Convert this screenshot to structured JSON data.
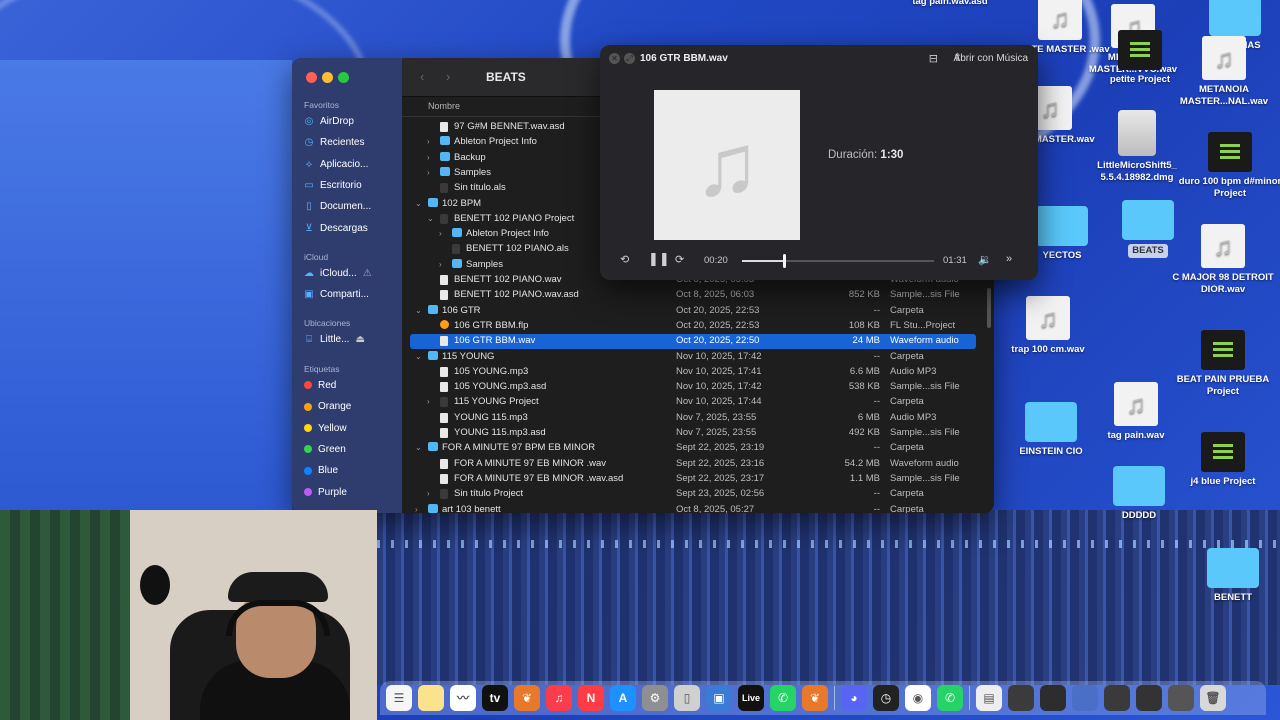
{
  "desktop": {
    "icons": [
      {
        "label": "tag pain.wav.asd"
      },
      {
        "label": "PETITE MASTER .wav"
      },
      {
        "label": "METENOIA MASTER...VVC.wav"
      },
      {
        "label": "LIBRERIAS"
      },
      {
        "label": "petite Project"
      },
      {
        "label": "METANOIA MASTER...NAL.wav"
      },
      {
        "label": "BLUE MASTER.wav"
      },
      {
        "label": "LittleMicroShift5_ 5.5.4.18982.dmg"
      },
      {
        "label": "duro 100 bpm d#minor Project"
      },
      {
        "label": "YECTOS"
      },
      {
        "label": "BEATS"
      },
      {
        "label": "C MAJOR 98 DETROIT DIOR.wav"
      },
      {
        "label": "trap 100 cm.wav"
      },
      {
        "label": "BEAT PAIN PRUEBA Project"
      },
      {
        "label": "tag pain.wav"
      },
      {
        "label": "EINSTEIN CIO"
      },
      {
        "label": "j4 blue Project"
      },
      {
        "label": "DDDDD"
      },
      {
        "label": "BENETT"
      }
    ]
  },
  "finder": {
    "title": "BEATS",
    "sidebar": {
      "favorites_header": "Favoritos",
      "favorites": [
        {
          "label": "AirDrop",
          "icon": "airdrop-icon"
        },
        {
          "label": "Recientes",
          "icon": "clock-icon"
        },
        {
          "label": "Aplicacio...",
          "icon": "applications-icon"
        },
        {
          "label": "Escritorio",
          "icon": "desktop-icon"
        },
        {
          "label": "Documen...",
          "icon": "document-icon"
        },
        {
          "label": "Descargas",
          "icon": "download-icon"
        }
      ],
      "icloud_header": "iCloud",
      "icloud": [
        {
          "label": "iCloud...",
          "icon": "cloud-icon"
        },
        {
          "label": "Comparti...",
          "icon": "shared-folder-icon"
        }
      ],
      "locations_header": "Ubicaciones",
      "locations": [
        {
          "label": "Little...",
          "icon": "disk-icon"
        }
      ],
      "tags_header": "Etiquetas",
      "tags": [
        {
          "label": "Red",
          "color": "#ff453a"
        },
        {
          "label": "Orange",
          "color": "#ff9f0a"
        },
        {
          "label": "Yellow",
          "color": "#ffd60a"
        },
        {
          "label": "Green",
          "color": "#32d74b"
        },
        {
          "label": "Blue",
          "color": "#0a84ff"
        },
        {
          "label": "Purple",
          "color": "#bf5af2"
        }
      ]
    },
    "columns": {
      "name": "Nombre"
    },
    "rows": [
      {
        "name": "97 G#M BENNET.wav.asd",
        "date": "",
        "size": "",
        "kind": "",
        "type": "file",
        "indent": 1,
        "chev": ""
      },
      {
        "name": "Ableton Project Info",
        "date": "",
        "size": "",
        "kind": "",
        "type": "folder",
        "indent": 1,
        "chev": "›"
      },
      {
        "name": "Backup",
        "date": "",
        "size": "",
        "kind": "",
        "type": "folder",
        "indent": 1,
        "chev": "›"
      },
      {
        "name": "Samples",
        "date": "",
        "size": "",
        "kind": "",
        "type": "folder",
        "indent": 1,
        "chev": "›"
      },
      {
        "name": "Sin título.als",
        "date": "",
        "size": "",
        "kind": "",
        "type": "proj",
        "indent": 1,
        "chev": ""
      },
      {
        "name": "102 BPM",
        "date": "",
        "size": "",
        "kind": "",
        "type": "folder",
        "indent": 0,
        "chev": "⌄"
      },
      {
        "name": "BENETT 102 PIANO Project",
        "date": "",
        "size": "",
        "kind": "",
        "type": "proj",
        "indent": 1,
        "chev": "⌄"
      },
      {
        "name": "Ableton Project Info",
        "date": "",
        "size": "",
        "kind": "",
        "type": "folder",
        "indent": 2,
        "chev": "›"
      },
      {
        "name": "BENETT 102 PIANO.als",
        "date": "",
        "size": "",
        "kind": "",
        "type": "proj",
        "indent": 2,
        "chev": ""
      },
      {
        "name": "Samples",
        "date": "",
        "size": "",
        "kind": "",
        "type": "folder",
        "indent": 2,
        "chev": "›"
      },
      {
        "name": "BENETT 102 PIANO.wav",
        "date": "Oct 8, 2025, 05:03",
        "size": "",
        "kind": "Waveform audio",
        "type": "file",
        "indent": 1,
        "chev": ""
      },
      {
        "name": "BENETT 102 PIANO.wav.asd",
        "date": "Oct 8, 2025, 06:03",
        "size": "852 KB",
        "kind": "Sample...sis File",
        "type": "file",
        "indent": 1,
        "chev": ""
      },
      {
        "name": "106 GTR",
        "date": "Oct 20, 2025, 22:53",
        "size": "--",
        "kind": "Carpeta",
        "type": "folder",
        "indent": 0,
        "chev": "⌄"
      },
      {
        "name": "106 GTR BBM.flp",
        "date": "Oct 20, 2025, 22:53",
        "size": "108 KB",
        "kind": "FL Stu...Project",
        "type": "flp",
        "indent": 1,
        "chev": ""
      },
      {
        "name": "106 GTR BBM.wav",
        "date": "Oct 20, 2025, 22:50",
        "size": "24 MB",
        "kind": "Waveform audio",
        "type": "file",
        "indent": 1,
        "chev": "",
        "selected": true
      },
      {
        "name": "115 YOUNG",
        "date": "Nov 10, 2025, 17:42",
        "size": "--",
        "kind": "Carpeta",
        "type": "folder",
        "indent": 0,
        "chev": "⌄"
      },
      {
        "name": "105 YOUNG.mp3",
        "date": "Nov 10, 2025, 17:41",
        "size": "6.6 MB",
        "kind": "Audio MP3",
        "type": "file",
        "indent": 1,
        "chev": ""
      },
      {
        "name": "105 YOUNG.mp3.asd",
        "date": "Nov 10, 2025, 17:42",
        "size": "538 KB",
        "kind": "Sample...sis File",
        "type": "file",
        "indent": 1,
        "chev": ""
      },
      {
        "name": "115 YOUNG  Project",
        "date": "Nov 10, 2025, 17:44",
        "size": "--",
        "kind": "Carpeta",
        "type": "proj",
        "indent": 1,
        "chev": "›"
      },
      {
        "name": "YOUNG 115.mp3",
        "date": "Nov 7, 2025, 23:55",
        "size": "6 MB",
        "kind": "Audio MP3",
        "type": "file",
        "indent": 1,
        "chev": ""
      },
      {
        "name": "YOUNG 115.mp3.asd",
        "date": "Nov 7, 2025, 23:55",
        "size": "492 KB",
        "kind": "Sample...sis File",
        "type": "file",
        "indent": 1,
        "chev": ""
      },
      {
        "name": "FOR A MINUTE 97 BPM EB MINOR",
        "date": "Sept 22, 2025, 23:19",
        "size": "--",
        "kind": "Carpeta",
        "type": "folder",
        "indent": 0,
        "chev": "⌄"
      },
      {
        "name": "FOR A MINUTE 97 EB MINOR .wav",
        "date": "Sept 22, 2025, 23:16",
        "size": "54.2 MB",
        "kind": "Waveform audio",
        "type": "file",
        "indent": 1,
        "chev": ""
      },
      {
        "name": "FOR A MINUTE 97 EB MINOR .wav.asd",
        "date": "Sept 22, 2025, 23:17",
        "size": "1.1 MB",
        "kind": "Sample...sis File",
        "type": "file",
        "indent": 1,
        "chev": ""
      },
      {
        "name": "Sin título Project",
        "date": "Sept 23, 2025, 02:56",
        "size": "--",
        "kind": "Carpeta",
        "type": "proj",
        "indent": 1,
        "chev": "›"
      },
      {
        "name": "art 103 benett",
        "date": "Oct 8, 2025, 05:27",
        "size": "--",
        "kind": "Carpeta",
        "type": "folder",
        "indent": 0,
        "chev": "›"
      }
    ]
  },
  "quicklook": {
    "title": "106 GTR BBM.wav",
    "open_with": "Abrir con Música",
    "duration_label": "Duración:",
    "duration_value": "1:30",
    "elapsed": "00:20",
    "remaining": "01:31",
    "progress": 0.22
  },
  "dock": {
    "apps": [
      {
        "name": "reminders-icon",
        "color": "#f5f5f5",
        "glyph": "☰"
      },
      {
        "name": "notes-icon",
        "color": "#fbe38e",
        "glyph": ""
      },
      {
        "name": "freeform-icon",
        "color": "#ffffff",
        "glyph": "〰"
      },
      {
        "name": "apple-tv-icon",
        "color": "#111111",
        "glyph": "tv"
      },
      {
        "name": "fl-studio-icon",
        "color": "#e8782a",
        "glyph": "❦"
      },
      {
        "name": "music-icon",
        "color": "#fa3c4c",
        "glyph": "♫"
      },
      {
        "name": "news-icon",
        "color": "#ff3b45",
        "glyph": "N"
      },
      {
        "name": "app-store-icon",
        "color": "#1e90ff",
        "glyph": "A"
      },
      {
        "name": "system-settings-icon",
        "color": "#8e8e93",
        "glyph": "⚙"
      },
      {
        "name": "iphone-mirroring-icon",
        "color": "#d0d0d0",
        "glyph": "▯"
      },
      {
        "name": "screen-sharing-icon",
        "color": "#3a7bd5",
        "glyph": "▣"
      },
      {
        "name": "ableton-live-icon",
        "color": "#111111",
        "glyph": "Live"
      },
      {
        "name": "whatsapp-icon",
        "color": "#25d366",
        "glyph": "✆"
      },
      {
        "name": "fl-studio-2-icon",
        "color": "#e8782a",
        "glyph": "❦"
      },
      {
        "name": "sep",
        "color": "",
        "glyph": ""
      },
      {
        "name": "discord-icon",
        "color": "#5865f2",
        "glyph": "◕"
      },
      {
        "name": "clock-app-icon",
        "color": "#222222",
        "glyph": "◷"
      },
      {
        "name": "chrome-icon",
        "color": "#ffffff",
        "glyph": "◉"
      },
      {
        "name": "whatsapp-2-icon",
        "color": "#25d366",
        "glyph": "✆"
      },
      {
        "name": "sep",
        "color": "",
        "glyph": ""
      },
      {
        "name": "document-stack-icon",
        "color": "#eeeeee",
        "glyph": "▤"
      },
      {
        "name": "window-1-icon",
        "color": "#3b3b3b",
        "glyph": ""
      },
      {
        "name": "window-2-icon",
        "color": "#2d2d2d",
        "glyph": ""
      },
      {
        "name": "window-3-icon",
        "color": "#4a6fc7",
        "glyph": ""
      },
      {
        "name": "window-4-icon",
        "color": "#3a3a3a",
        "glyph": ""
      },
      {
        "name": "window-5-icon",
        "color": "#333333",
        "glyph": ""
      },
      {
        "name": "window-6-icon",
        "color": "#555555",
        "glyph": ""
      },
      {
        "name": "trash-icon",
        "color": "#d8d8d8",
        "glyph": "🗑"
      }
    ]
  }
}
